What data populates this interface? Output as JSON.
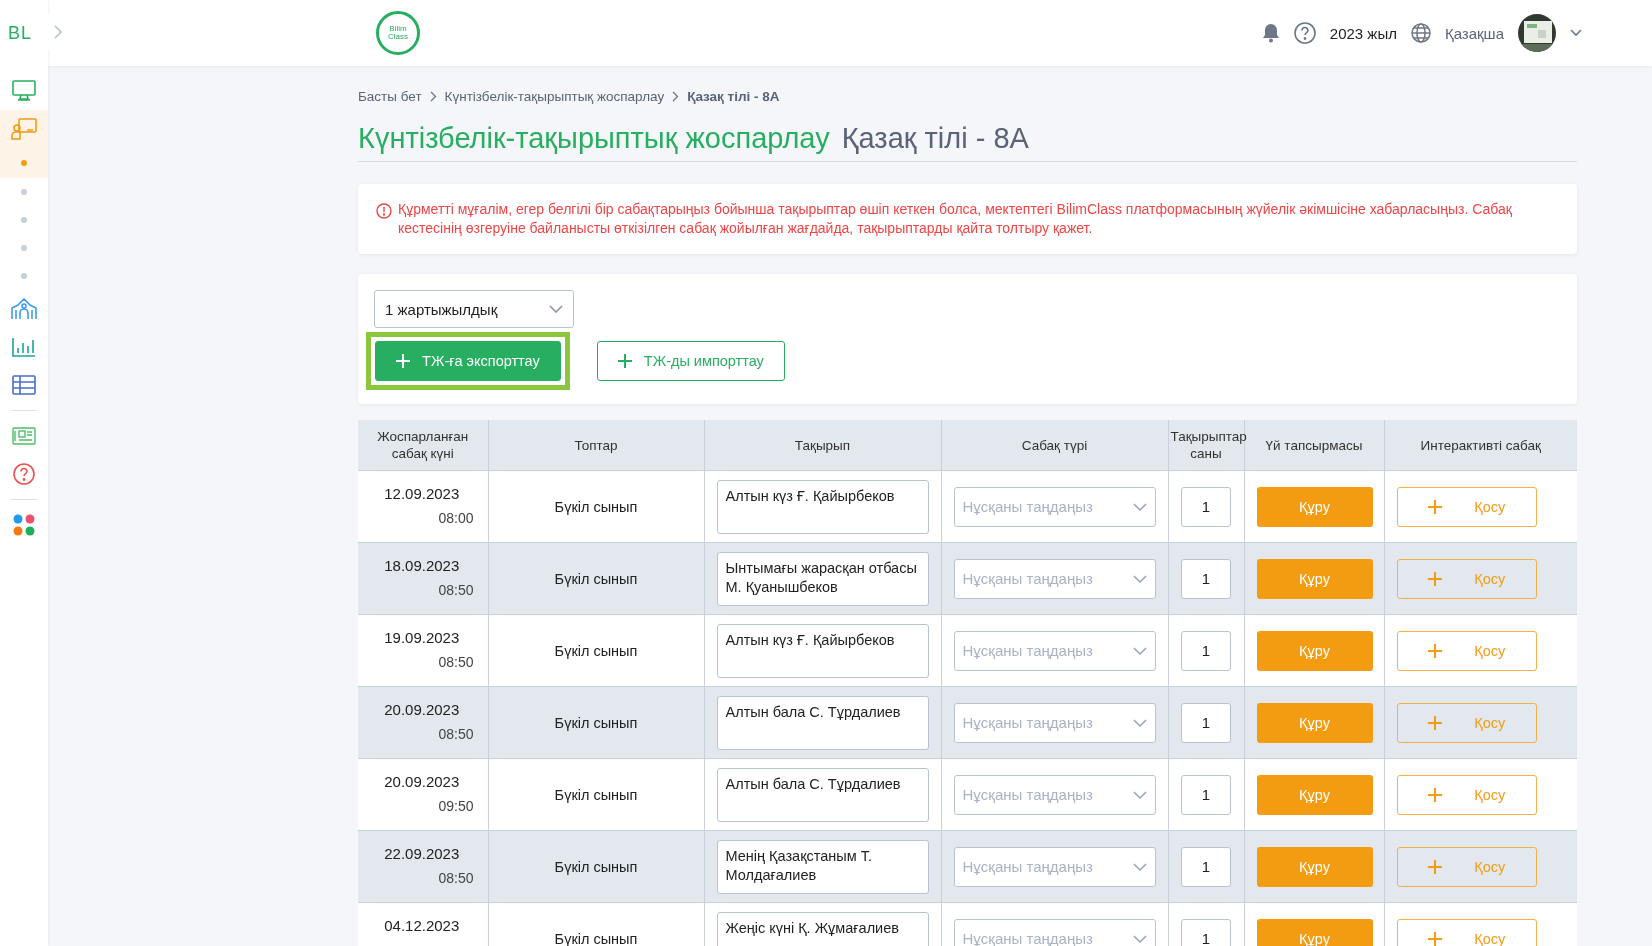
{
  "sidebar": {
    "logo": "BL",
    "items": [
      {
        "kind": "monitor",
        "selected": false
      },
      {
        "kind": "classroom",
        "selected": true,
        "children": [
          {
            "selected": true
          },
          {
            "selected": false
          },
          {
            "selected": false
          },
          {
            "selected": false
          },
          {
            "selected": false
          }
        ]
      },
      {
        "kind": "school",
        "selected": false
      },
      {
        "kind": "chart",
        "selected": false
      },
      {
        "kind": "table",
        "selected": false
      },
      {
        "kind": "news",
        "selected": false
      },
      {
        "kind": "help",
        "selected": false
      },
      {
        "kind": "apps",
        "selected": false
      }
    ]
  },
  "header": {
    "logo_text": [
      "Bilim",
      "Class"
    ],
    "year": "2023 жыл",
    "language": "Қазақша"
  },
  "breadcrumbs": [
    {
      "label": "Басты бет",
      "current": false
    },
    {
      "label": "Күнтізбелік-тақырыптық жоспарлау",
      "current": false
    },
    {
      "label": "Қазақ тілі - 8А",
      "current": true
    }
  ],
  "title": {
    "main": "Күнтізбелік-тақырыптық жоспарлау",
    "subject": "Қазақ тілі - 8А"
  },
  "alert": "Құрметті мұғалім, егер белгілі бір сабақтарыңыз бойынша тақырыптар өшіп кеткен болса, мектептегі BilimClass платформасының жүйелік әкімшісіне хабарласыңыз. Сабақ кестесінің өзгеруіне байланысты өткізілген сабақ жойылған жағдайда, тақырыптарды қайта толтыру қажет.",
  "controls": {
    "period": "1 жартыжылдық",
    "buttons": [
      {
        "label": "ТЖ-ға экспорттау",
        "kind": "primary",
        "highlighted": true
      },
      {
        "label": "ТЖ-ды импорттау",
        "kind": "outline",
        "highlighted": false
      }
    ]
  },
  "table": {
    "columns": [
      "Жоспарланған сабақ күні",
      "Топтар",
      "Тақырып",
      "Сабақ түрі",
      "Тақырыптар саны",
      "Үй тапсырмасы",
      "Интерактивті сабақ"
    ],
    "rows": [
      {
        "date": "12.09.2023",
        "time": "08:00",
        "group": "Бүкіл сынып",
        "topic": "Алтын күз Ғ. Қайырбеков",
        "lesson_type": "Нұсқаны таңдаңыз",
        "count": "1",
        "homework": "Құру",
        "interactive": "Қосу"
      },
      {
        "date": "18.09.2023",
        "time": "08:50",
        "group": "Бүкіл сынып",
        "topic": "Ынтымағы жарасқан отбасы М. Қуанышбеков",
        "lesson_type": "Нұсқаны таңдаңыз",
        "count": "1",
        "homework": "Құру",
        "interactive": "Қосу"
      },
      {
        "date": "19.09.2023",
        "time": "08:50",
        "group": "Бүкіл сынып",
        "topic": "Алтын күз Ғ. Қайырбеков",
        "lesson_type": "Нұсқаны таңдаңыз",
        "count": "1",
        "homework": "Құру",
        "interactive": "Қосу"
      },
      {
        "date": "20.09.2023",
        "time": "08:50",
        "group": "Бүкіл сынып",
        "topic": "Алтын бала С. Тұрдалиев",
        "lesson_type": "Нұсқаны таңдаңыз",
        "count": "1",
        "homework": "Құру",
        "interactive": "Қосу"
      },
      {
        "date": "20.09.2023",
        "time": "09:50",
        "group": "Бүкіл сынып",
        "topic": "Алтын бала С. Тұрдалиев",
        "lesson_type": "Нұсқаны таңдаңыз",
        "count": "1",
        "homework": "Құру",
        "interactive": "Қосу"
      },
      {
        "date": "22.09.2023",
        "time": "08:50",
        "group": "Бүкіл сынып",
        "topic": "Менің Қазақстаным Т. Молдағалиев",
        "lesson_type": "Нұсқаны таңдаңыз",
        "count": "1",
        "homework": "Құру",
        "interactive": "Қосу"
      },
      {
        "date": "04.12.2023",
        "group": "Бүкіл сынып",
        "topic": "Жеңіс күні Қ. Жұмағалиев",
        "lesson_type": "Нұсқаны таңдаңыз",
        "count": "1",
        "homework": "Құру",
        "interactive": "Қосу"
      }
    ]
  }
}
